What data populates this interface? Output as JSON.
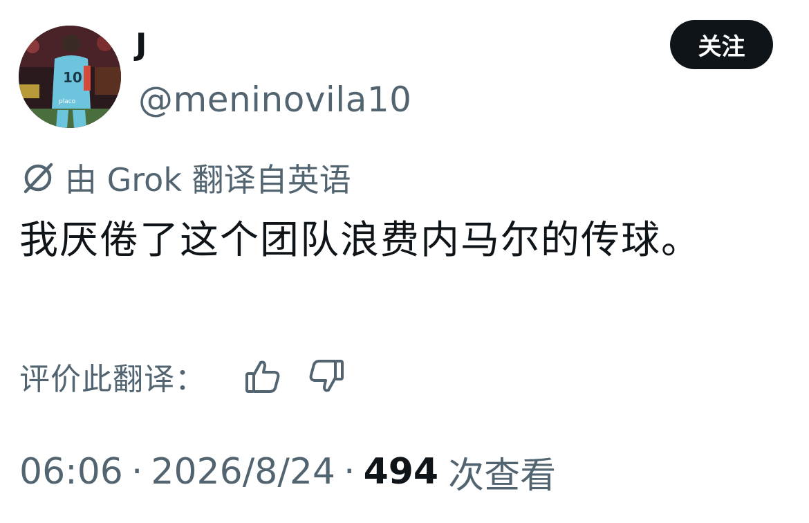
{
  "author": {
    "display_name": "J",
    "handle": "@meninovila10"
  },
  "actions": {
    "follow_label": "关注"
  },
  "translation": {
    "note": "由 Grok 翻译自英语"
  },
  "tweet": {
    "text": "我厌倦了这个团队浪费内马尔的传球。"
  },
  "rating": {
    "label": "评价此翻译："
  },
  "meta": {
    "time": "06:06",
    "separator": "·",
    "date": "2026/8/24",
    "views_count": "494",
    "views_label": "次查看"
  },
  "icons": {
    "grok": "grok-logo-icon",
    "thumbs_up": "thumbs-up-icon",
    "thumbs_down": "thumbs-down-icon"
  },
  "colors": {
    "text_primary": "#0f1419",
    "text_secondary": "#536471",
    "button_bg": "#0f1419"
  }
}
